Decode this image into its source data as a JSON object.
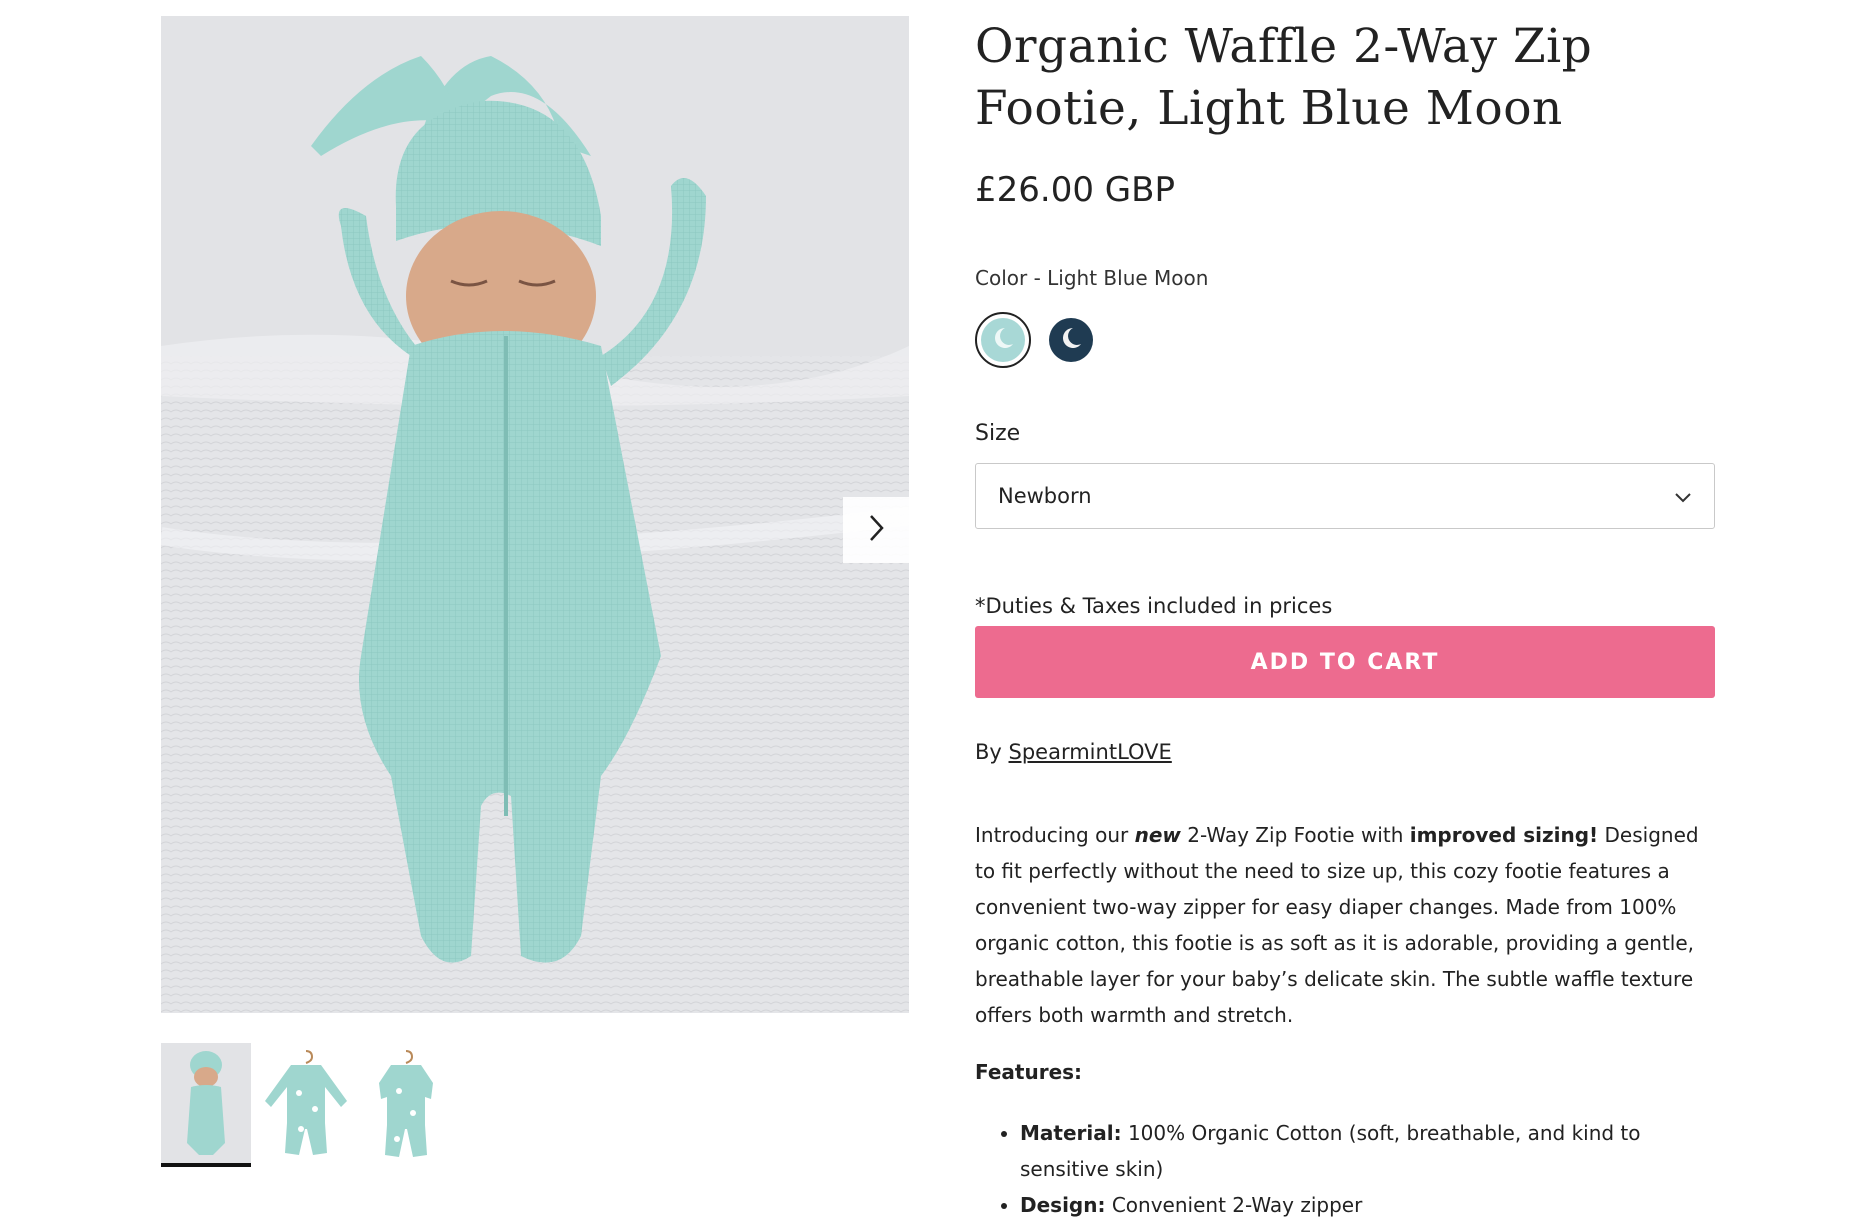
{
  "product": {
    "title": "Organic Waffle 2-Way Zip Footie, Light Blue Moon",
    "price": "£26.00 GBP",
    "color_label": "Color - Light Blue Moon",
    "size_label": "Size",
    "size_selected": "Newborn",
    "duties_note": "*Duties & Taxes included in prices",
    "add_to_cart": "ADD TO CART",
    "vendor_prefix": "By ",
    "vendor_name": "SpearmintLOVE",
    "description": {
      "intro": "Introducing our ",
      "new": "new",
      "mid": " 2-Way Zip Footie with ",
      "improved": "improved sizing!",
      "rest": " Designed to fit perfectly without the need to size up, this cozy footie features a convenient two-way zipper for easy diaper changes. Made from 100% organic cotton, this footie is as soft as it is adorable, providing a gentle, breathable layer for your baby’s delicate skin. The subtle waffle texture offers both warmth and stretch."
    },
    "features_heading": "Features:",
    "features": [
      {
        "label": "Material:",
        "text": " 100% Organic Cotton (soft, breathable, and kind to sensitive skin)"
      },
      {
        "label": "Design:",
        "text": " Convenient 2-Way zipper"
      }
    ]
  },
  "swatches": [
    {
      "name": "Light Blue Moon",
      "color": "#a8d8d6",
      "selected": true
    },
    {
      "name": "Navy Moon",
      "color": "#1f3b52",
      "selected": false
    }
  ],
  "colors": {
    "accent": "#ed6b8f",
    "footie": "#9fd6cf"
  },
  "icons": {
    "next": "chevron-right-icon",
    "select": "chevron-down-icon"
  }
}
